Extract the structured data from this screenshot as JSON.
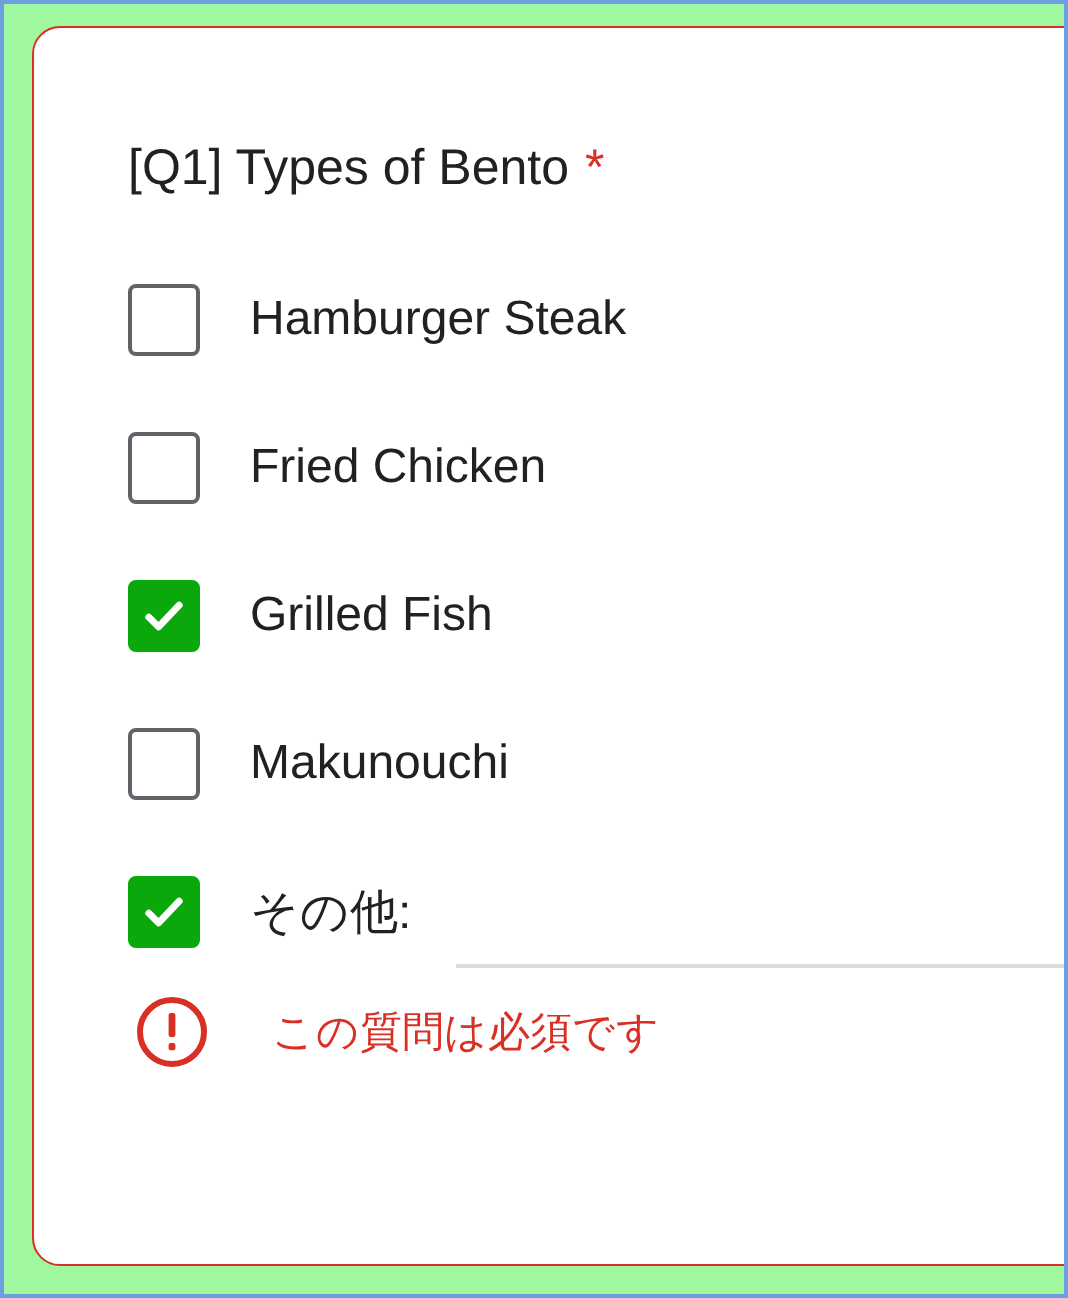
{
  "question": {
    "title": "[Q1] Types of Bento",
    "required_mark": "*"
  },
  "options": [
    {
      "kind": "option",
      "label": "Hamburger Steak",
      "checked": false
    },
    {
      "kind": "option",
      "label": "Fried Chicken",
      "checked": false
    },
    {
      "kind": "option",
      "label": "Grilled Fish",
      "checked": true
    },
    {
      "kind": "option",
      "label": "Makunouchi",
      "checked": false
    },
    {
      "kind": "other",
      "label": "その他:",
      "checked": true
    }
  ],
  "error": {
    "message": "この質問は必須です"
  }
}
